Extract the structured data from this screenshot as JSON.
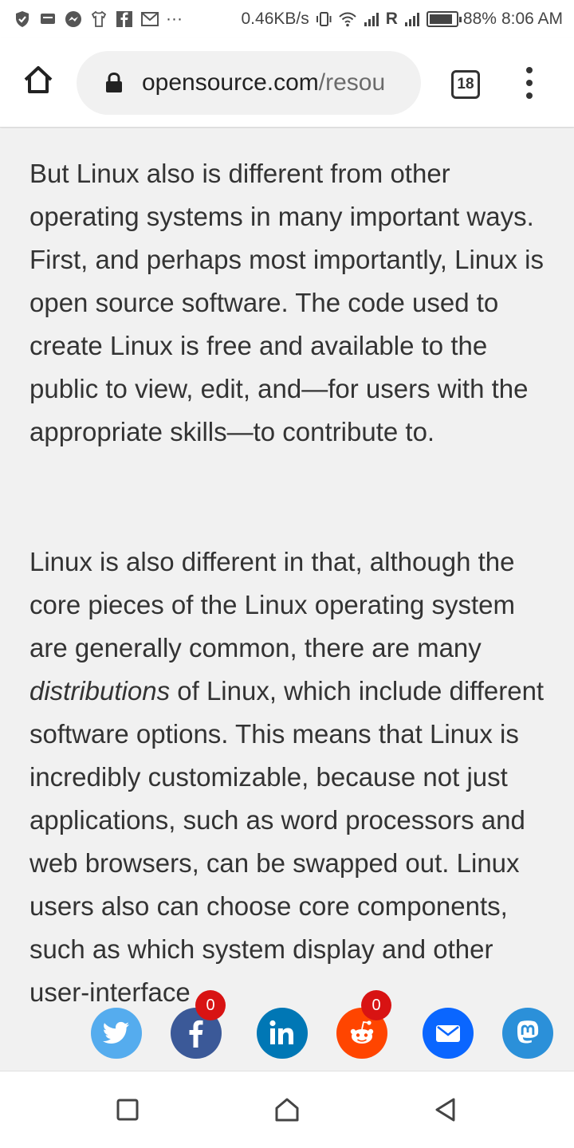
{
  "status_bar": {
    "data_rate": "0.46KB/s",
    "battery_percent": "88%",
    "battery_level": 0.88,
    "time": "8:06 AM",
    "icons": [
      "shield-icon",
      "message-icon",
      "messenger-icon",
      "shirt-icon",
      "facebook-icon",
      "gmail-icon",
      "more-icon",
      "vibrate-icon",
      "wifi-icon",
      "signal-icon",
      "roaming-r",
      "signal-icon",
      "battery-icon"
    ],
    "roaming_label": "R",
    "overflow_label": "···"
  },
  "browser": {
    "url_domain": "opensource.com",
    "url_path": "/resou",
    "tab_count": "18"
  },
  "article": {
    "paragraph1": "But Linux also is different from other operating systems in many important ways. First, and perhaps most importantly, Linux is open source software. The code used to create Linux is free and available to the public to view, edit, and—for users with the appropriate skills—to contribute to.",
    "paragraph2_before": "Linux is also different in that, although the core pieces of the Linux operating system are generally common, there are many ",
    "paragraph2_emph": "distributions",
    "paragraph2_after": " of Linux, which include different software options. This means that Linux is incredibly customizable, because not just applications, such as word processors and web browsers, can be swapped out. Linux users also can choose core components, such as which system display and other user-interface"
  },
  "share_bar": {
    "buttons": [
      {
        "name": "twitter",
        "color": "#55acee"
      },
      {
        "name": "facebook",
        "color": "#3b5998",
        "count": "0"
      },
      {
        "name": "linkedin",
        "color": "#0077b5"
      },
      {
        "name": "reddit",
        "color": "#ff4500",
        "count": "0"
      },
      {
        "name": "email",
        "color": "#0a66ff"
      },
      {
        "name": "mastodon",
        "color": "#2b90d9"
      }
    ]
  },
  "colors": {
    "page_bg": "#f1f1f1",
    "text": "#333333",
    "badge": "#d81313"
  }
}
